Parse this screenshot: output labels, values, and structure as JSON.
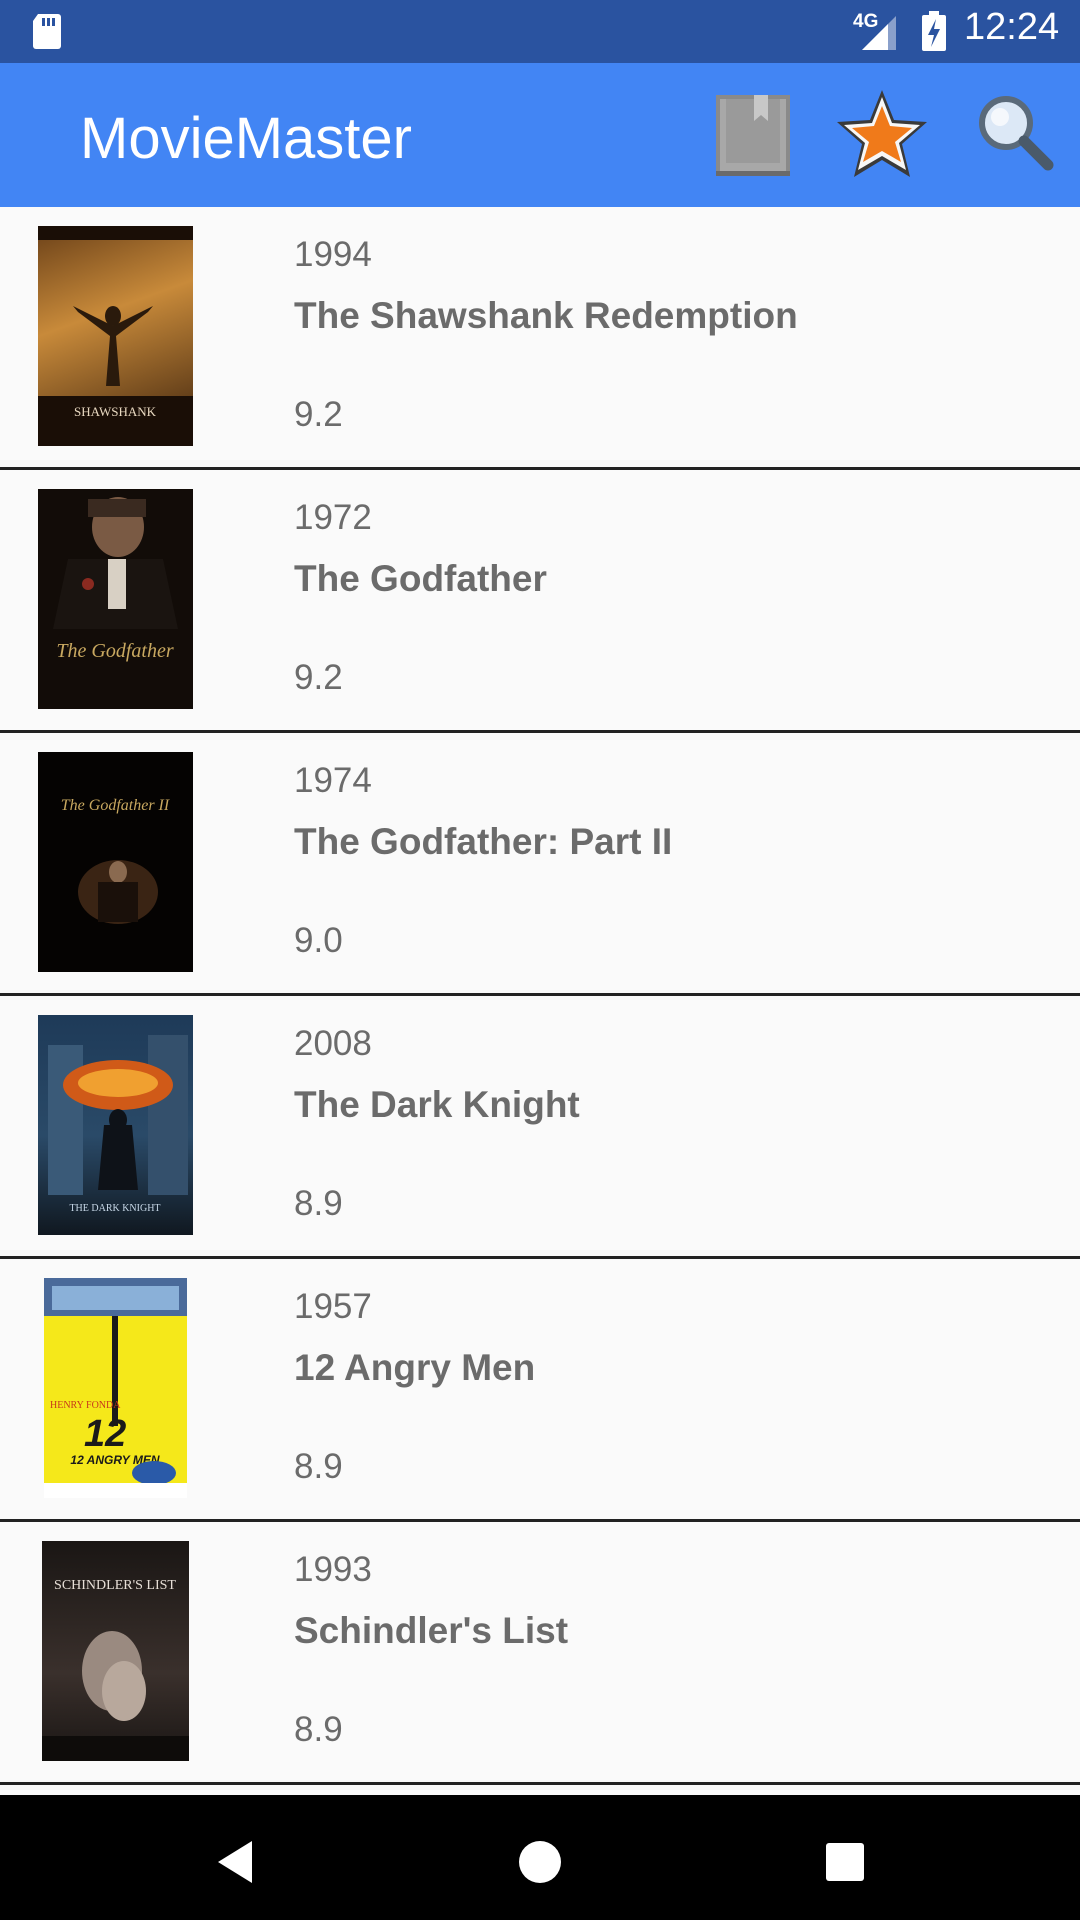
{
  "status_bar": {
    "network": "4G",
    "time": "12:24"
  },
  "app_bar": {
    "title": "MovieMaster",
    "actions": [
      {
        "name": "bookmarks",
        "icon": "bookmark-icon"
      },
      {
        "name": "favorites",
        "icon": "star-icon"
      },
      {
        "name": "search",
        "icon": "search-icon"
      }
    ]
  },
  "movies": [
    {
      "year": "1994",
      "title": "The Shawshank Redemption",
      "rating": "9.2",
      "poster_text": "SHAWSHANK",
      "poster_colors": [
        "#4a2a10",
        "#c88a3a"
      ]
    },
    {
      "year": "1972",
      "title": "The Godfather",
      "rating": "9.2",
      "poster_text": "The Godfather",
      "poster_colors": [
        "#120c08",
        "#5a4030"
      ]
    },
    {
      "year": "1974",
      "title": "The Godfather: Part II",
      "rating": "9.0",
      "poster_text": "The Godfather II",
      "poster_colors": [
        "#050302",
        "#3a2414"
      ]
    },
    {
      "year": "2008",
      "title": "The Dark Knight",
      "rating": "8.9",
      "poster_text": "THE DARK KNIGHT",
      "poster_colors": [
        "#1a3048",
        "#d05a18"
      ]
    },
    {
      "year": "1957",
      "title": "12 Angry Men",
      "rating": "8.9",
      "poster_text": "12 ANGRY MEN",
      "poster_colors": [
        "#f5e81a",
        "#2a5aa8"
      ]
    },
    {
      "year": "1993",
      "title": "Schindler's List",
      "rating": "8.9",
      "poster_text": "SCHINDLER'S LIST",
      "poster_colors": [
        "#2a2422",
        "#8a7a70"
      ]
    }
  ],
  "colors": {
    "status_bar": "#2a53a0",
    "app_bar": "#4285f4",
    "text_secondary": "#6b6b6b",
    "divider": "#222222",
    "star": "#f07a1a"
  }
}
